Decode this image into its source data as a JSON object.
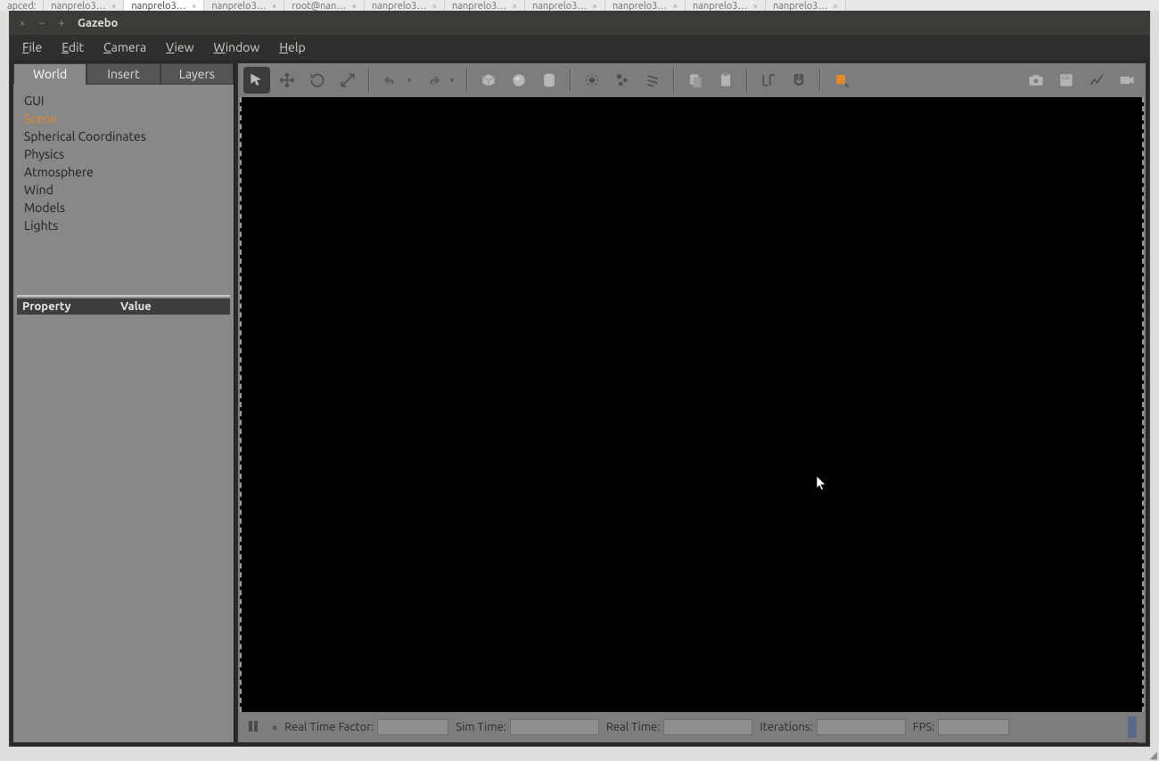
{
  "os_tabs": {
    "items": [
      {
        "label": "apced:"
      },
      {
        "label": "nanprelo3…"
      },
      {
        "label": "nanprelo3…",
        "active": true
      },
      {
        "label": "nanprelo3…"
      },
      {
        "label": "root@nan…"
      },
      {
        "label": "nanprelo3…"
      },
      {
        "label": "nanprelo3…"
      },
      {
        "label": "nanprelo3…"
      },
      {
        "label": "nanprelo3…"
      },
      {
        "label": "nanprelo3…"
      },
      {
        "label": "nanprelo3…"
      }
    ]
  },
  "titlebar": {
    "close": "×",
    "min": "−",
    "max": "+",
    "title": "Gazebo"
  },
  "menubar": {
    "items": [
      "File",
      "Edit",
      "Camera",
      "View",
      "Window",
      "Help"
    ]
  },
  "side_tabs": {
    "items": [
      "World",
      "Insert",
      "Layers"
    ],
    "active": 0
  },
  "world_tree": {
    "items": [
      {
        "label": "GUI"
      },
      {
        "label": "Scene",
        "selected": true
      },
      {
        "label": "Spherical Coordinates"
      },
      {
        "label": "Physics"
      },
      {
        "label": "Atmosphere"
      },
      {
        "label": "Wind"
      },
      {
        "label": "Models"
      },
      {
        "label": "Lights"
      }
    ]
  },
  "prop_header": {
    "col1": "Property",
    "col2": "Value"
  },
  "statusbar": {
    "rtf_label": "Real Time Factor:",
    "rtf_value": "",
    "simtime_label": "Sim Time:",
    "simtime_value": "",
    "realtime_label": "Real Time:",
    "realtime_value": "",
    "iter_label": "Iterations:",
    "iter_value": "",
    "fps_label": "FPS:",
    "fps_value": ""
  },
  "icons": {
    "highlight_color": "#e08a2c"
  }
}
